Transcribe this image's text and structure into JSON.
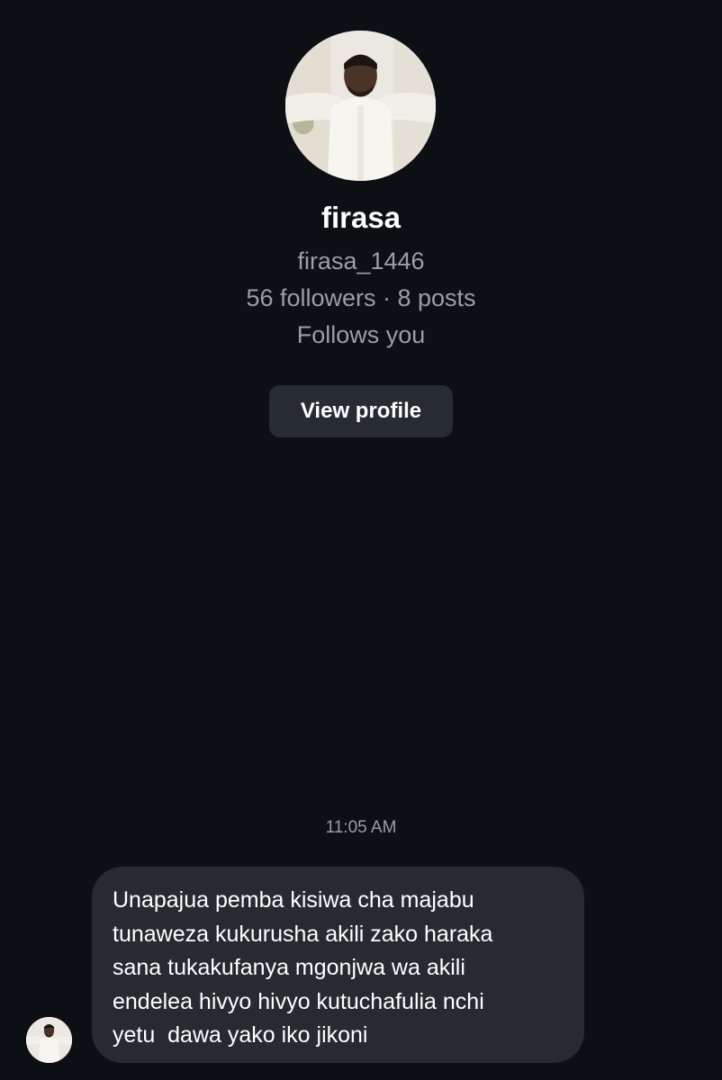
{
  "profile": {
    "display_name": "firasa",
    "username": "firasa_1446",
    "stats": "56 followers · 8 posts",
    "relationship": "Follows you",
    "view_profile_label": "View profile",
    "avatar_icon": "avatar-photo-icon"
  },
  "conversation": {
    "timestamp": "11:05 AM",
    "messages": [
      {
        "direction": "incoming",
        "text": "Unapajua pemba kisiwa cha majabu\ntunaweza kukurusha akili zako haraka\nsana tukakufanya mgonjwa wa akili\nendelea hivyo hivyo kutuchafulia nchi\nyetu  dawa yako iko jikoni"
      }
    ]
  },
  "colors": {
    "background": "#0c0f14",
    "secondary_text": "#9a9ea5",
    "button_bg": "#272b32",
    "bubble_bg": "#272a30",
    "primary_text": "#ffffff"
  }
}
